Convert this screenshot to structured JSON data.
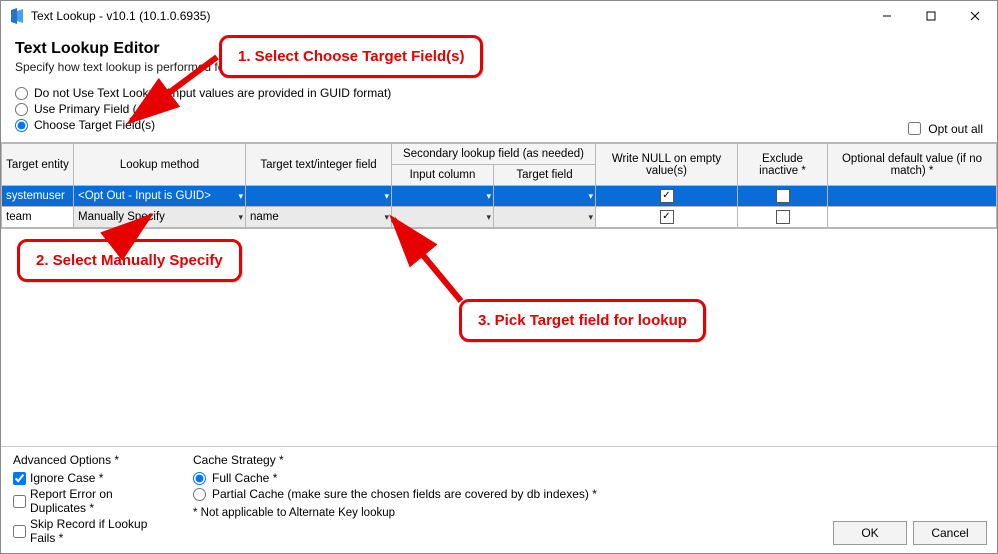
{
  "window": {
    "title": "Text Lookup - v10.1 (10.1.0.6935)"
  },
  "header": {
    "title": "Text Lookup Editor",
    "subtitle": "Specify how text lookup is performed fo"
  },
  "radios": {
    "opt0": "Do not Use Text Lookup (Input values are provided in GUID format)",
    "opt1": "Use Primary Field (All)",
    "opt2": "Choose Target Field(s)",
    "opt_out_all": "Opt out all"
  },
  "grid": {
    "headers": {
      "target_entity": "Target entity",
      "lookup_method": "Lookup method",
      "target_text_field": "Target text/integer field",
      "secondary_group": "Secondary lookup field (as needed)",
      "input_column": "Input column",
      "target_field": "Target field",
      "write_null": "Write NULL on empty value(s)",
      "exclude_inactive": "Exclude inactive *",
      "optional_default": "Optional default value (if no match) *"
    },
    "rows": [
      {
        "entity": "systemuser",
        "method": "<Opt Out - Input is GUID>",
        "target_text": "",
        "input_col": "",
        "target_field": "",
        "write_null": true,
        "exclude_inactive": false,
        "default": ""
      },
      {
        "entity": "team",
        "method": "Manually Specify",
        "target_text": "name",
        "input_col": "",
        "target_field": "",
        "write_null": true,
        "exclude_inactive": false,
        "default": ""
      }
    ]
  },
  "advanced": {
    "title": "Advanced Options *",
    "ignore_case": "Ignore Case *",
    "report_error": "Report Error on Duplicates *",
    "skip_record": "Skip Record if Lookup Fails *"
  },
  "cache": {
    "title": "Cache Strategy *",
    "full": "Full Cache *",
    "partial": "Partial Cache (make sure the chosen fields are covered by db indexes) *",
    "note": "* Not applicable to Alternate Key lookup"
  },
  "buttons": {
    "ok": "OK",
    "cancel": "Cancel"
  },
  "annotations": {
    "step1": "1. Select Choose Target Field(s)",
    "step2": "2. Select Manually Specify",
    "step3": "3. Pick Target field for lookup"
  }
}
